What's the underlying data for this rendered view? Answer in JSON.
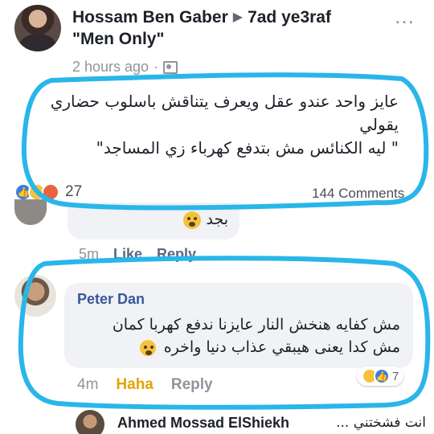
{
  "post": {
    "author": "Hossam Ben Gaber",
    "group": "7ad ye3raf",
    "subgroup": "\"Men Only\"",
    "time": "2 hours ago",
    "more_label": "…",
    "text_lines": [
      "عايز واحد عندو عقل ويعرف يتناقش باسلوب حضاري",
      "يقولي",
      "\" ليه الكنائس مش بتدفع كهرباء زي المساجد\""
    ],
    "reaction_count": "27",
    "comments_count": "144 Comments"
  },
  "comment1": {
    "text": "بجد",
    "time": "5m",
    "like_label": "Like",
    "reply_label": "Reply"
  },
  "comment2": {
    "author": "Peter Dan",
    "text_lines": [
      "مش كفايه هنخش النار عايزنا ندفع كهربا كمان",
      "مش كدا يعنى هيبقي عذاب دنيا واخره"
    ],
    "time": "4m",
    "haha_label": "Haha",
    "reply_label": "Reply",
    "reaction_count": "7"
  },
  "reply": {
    "author": "Ahmed Mossad ElShiekh",
    "text": "انت فشختني ..."
  },
  "colors": {
    "highlight": "#29b6e8",
    "link_blue": "#385898",
    "haha_yellow": "#e4a300",
    "bubble_bg": "#f0f2f5"
  }
}
